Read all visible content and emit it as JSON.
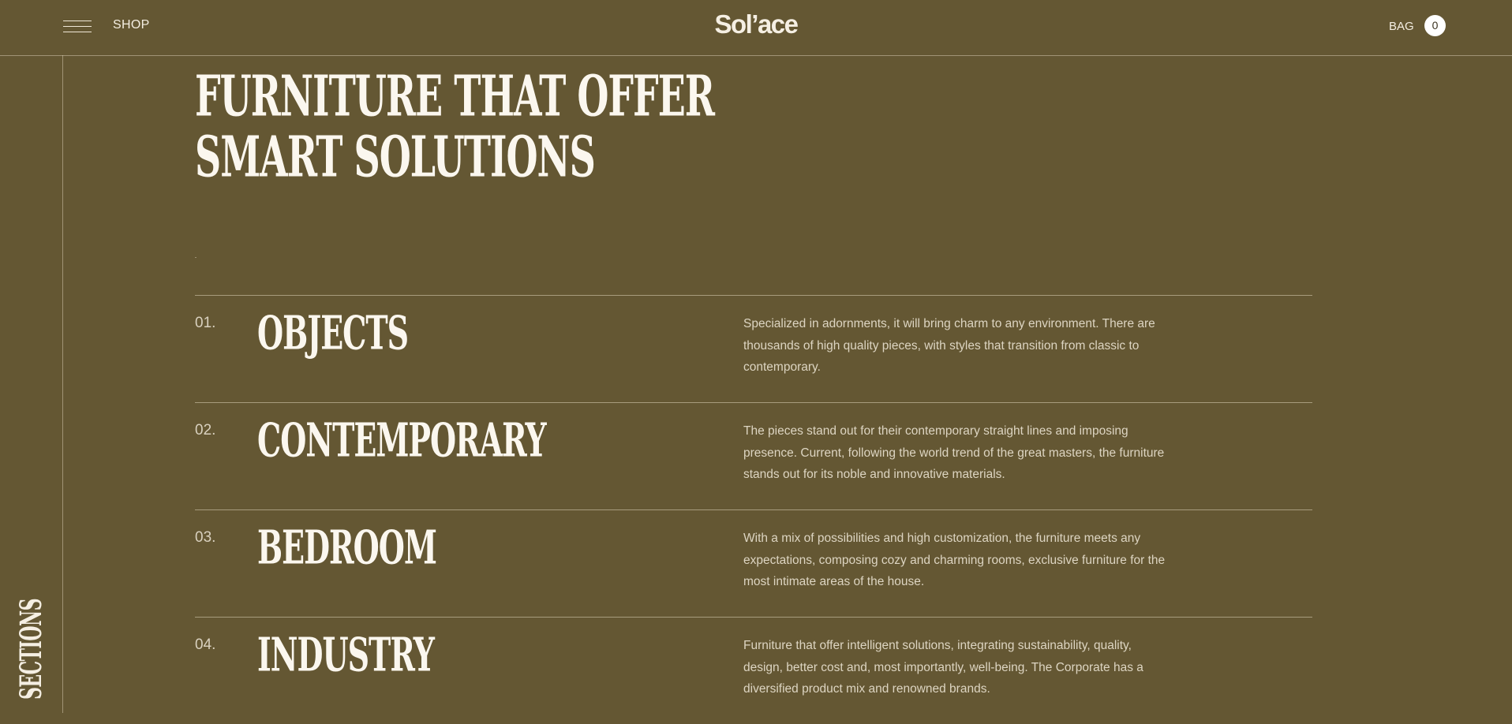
{
  "header": {
    "menu_icon": "hamburger-menu-icon",
    "shop_label": "SHOP",
    "logo_text": "Sol’ace",
    "bag_label": "BAG",
    "bag_count": "0"
  },
  "sidebar": {
    "sections_label": "SECTIONS"
  },
  "hero": {
    "title_line_1": "FURNITURE THAT OFFER",
    "title_line_2": "SMART SOLUTIONS"
  },
  "sections": [
    {
      "number": "01.",
      "title": "OBJECTS",
      "description": "Specialized in adornments, it will bring charm to any environment. There are thousands of high quality pieces, with styles that transition from classic to contemporary."
    },
    {
      "number": "02.",
      "title": "CONTEMPORARY",
      "description": "The pieces stand out for their contemporary straight lines and imposing presence. Current, following the world trend of the great masters, the furniture stands out for its noble and innovative materials."
    },
    {
      "number": "03.",
      "title": "BEDROOM",
      "description": "With a mix of possibilities and high customization, the furniture meets any expectations, composing cozy and charming rooms, exclusive furniture for the most intimate areas of the house."
    },
    {
      "number": "04.",
      "title": "INDUSTRY",
      "description": "Furniture that offer intelligent solutions, integrating sustainability, quality, design, better cost and, most importantly, well-being. The Corporate has a diversified product mix and renowned brands."
    }
  ],
  "colors": {
    "background": "#645733",
    "text_primary": "#fbf7ef",
    "text_secondary": "#ddd5c2",
    "badge_background": "#ffffff"
  }
}
